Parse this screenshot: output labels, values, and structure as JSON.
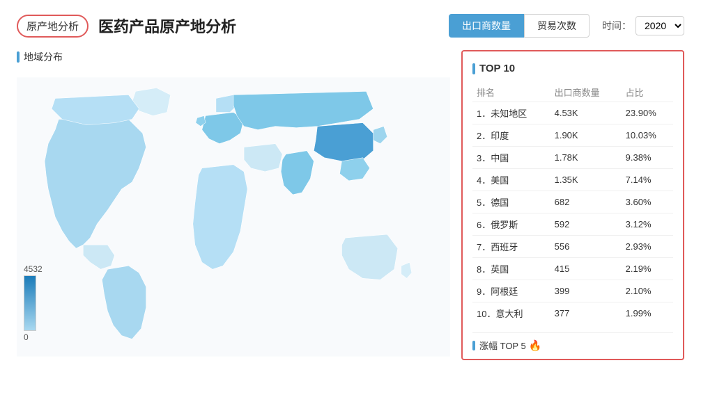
{
  "header": {
    "breadcrumb": "原产地分析",
    "title": "医药产品原产地分析",
    "tab_active": "出口商数量",
    "tabs": [
      "出口商数量",
      "贸易次数"
    ],
    "time_label": "时间：",
    "year": "2020"
  },
  "map_section": {
    "label": "地域分布",
    "legend_max": "4532",
    "legend_min": "0"
  },
  "top10": {
    "title": "TOP 10",
    "columns": [
      "排名",
      "出口商数量",
      "占比"
    ],
    "rows": [
      {
        "rank": "1．未知地区",
        "value": "4.53K",
        "percent": "23.90%"
      },
      {
        "rank": "2．印度",
        "value": "1.90K",
        "percent": "10.03%"
      },
      {
        "rank": "3．中国",
        "value": "1.78K",
        "percent": "9.38%"
      },
      {
        "rank": "4．美国",
        "value": "1.35K",
        "percent": "7.14%"
      },
      {
        "rank": "5．德国",
        "value": "682",
        "percent": "3.60%"
      },
      {
        "rank": "6．俄罗斯",
        "value": "592",
        "percent": "3.12%"
      },
      {
        "rank": "7．西班牙",
        "value": "556",
        "percent": "2.93%"
      },
      {
        "rank": "8．英国",
        "value": "415",
        "percent": "2.19%"
      },
      {
        "rank": "9．阿根廷",
        "value": "399",
        "percent": "2.10%"
      },
      {
        "rank": "10．意大利",
        "value": "377",
        "percent": "1.99%"
      }
    ],
    "rise_label": "涨幅 TOP 5"
  }
}
